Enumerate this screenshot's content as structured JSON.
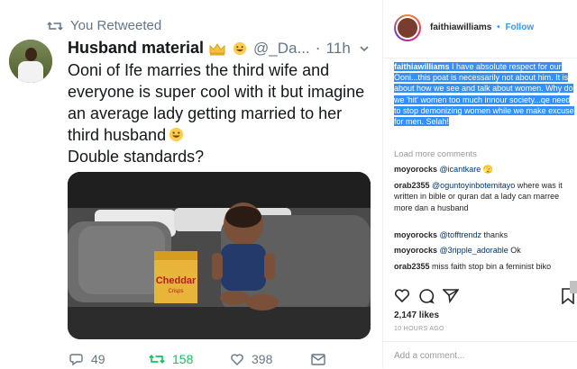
{
  "retweet_label": "You Retweeted",
  "tweet": {
    "display_name": "Husband material",
    "handle": "@_Da...",
    "separator": "·",
    "time": "11h",
    "text_lines": [
      "Ooni of Ife marries the third wife and",
      "everyone is super cool with it but imagine",
      "an average lady getting married to her",
      "third husband"
    ],
    "text_last": "Double standards?",
    "image_label_brand": "Cheddar",
    "image_label_sub": "Crisps",
    "stats": {
      "replies": "49",
      "retweets": "158",
      "likes": "398"
    },
    "colors": {
      "retweet_active": "#17bf63",
      "meta": "#657786",
      "text": "#14171a"
    }
  },
  "instagram": {
    "username": "faithiawilliams",
    "follow_sep": "•",
    "follow": "Follow",
    "caption_user": "faithiawilliams",
    "caption_text": " I have absolute respect for our Ooni...this poat is necessarily not about him. It is about how we see and talk about women. Why do we 'hit' women too much innour society...qe need to stop demonizing women while we make excuse for men. Selah!",
    "load_more": "Load more comments",
    "comments": [
      {
        "user": "moyorocks",
        "mention": "@icantkare",
        "text": " 🫣"
      },
      {
        "user": "orab2355",
        "mention": "@oguntoyinbotemitayo",
        "text": " where was it written in bible or quran dat a lady can marree more dan a husband"
      },
      {
        "user": "moyorocks",
        "mention": "@tofftrendz",
        "text": " thanks"
      },
      {
        "user": "moyorocks",
        "mention": "@3ripple_adorable",
        "text": " Ok"
      },
      {
        "user": "orab2355",
        "mention": "",
        "text": " miss faith stop bin a feminist biko"
      }
    ],
    "likes": "2,147 likes",
    "time": "10 HOURS AGO",
    "add_comment": "Add a comment...",
    "colors": {
      "link": "#3897f0",
      "highlight": "#3390ff",
      "muted": "#999999"
    }
  }
}
